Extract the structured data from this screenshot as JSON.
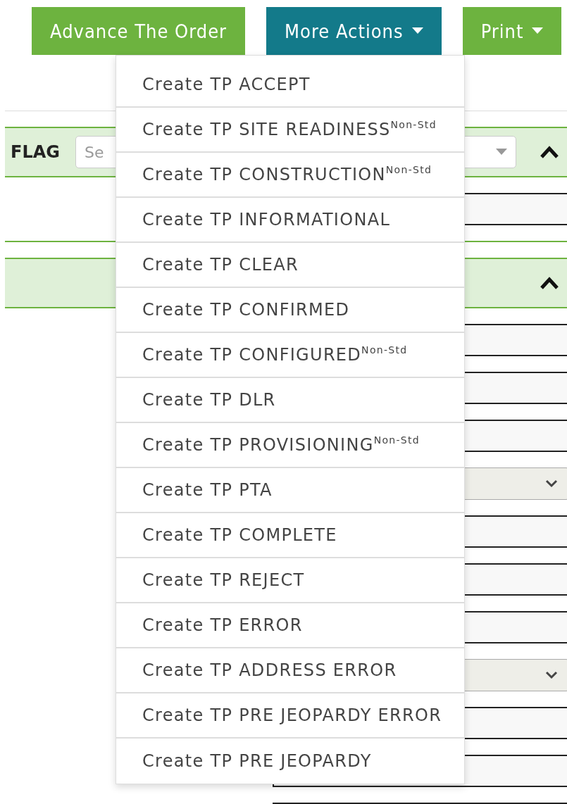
{
  "toolbar": {
    "buttons": [
      {
        "label": "Advance The Order",
        "kind": "primary",
        "caret": false
      },
      {
        "label": "More Actions",
        "kind": "menu",
        "caret": true,
        "expanded": true
      },
      {
        "label": "Print",
        "kind": "primary",
        "caret": true
      }
    ]
  },
  "sections": [
    {
      "label": "FLAG",
      "select": {
        "placeholder": "Se"
      },
      "expanded": true,
      "fields": [
        {
          "kind": "input"
        }
      ]
    },
    {
      "expanded": true,
      "fields": [
        {
          "kind": "input"
        },
        {
          "kind": "input"
        },
        {
          "kind": "input"
        },
        {
          "kind": "select"
        },
        {
          "kind": "input"
        },
        {
          "kind": "input"
        },
        {
          "kind": "input"
        },
        {
          "kind": "select"
        },
        {
          "kind": "input"
        },
        {
          "kind": "input"
        },
        {
          "kind": "input"
        }
      ]
    }
  ],
  "menu": {
    "items": [
      {
        "label": "Create TP ACCEPT"
      },
      {
        "label": "Create TP SITE READINESS$^{Non-Std}$"
      },
      {
        "label": "Create TP CONSTRUCTION$^{Non-Std}$"
      },
      {
        "label": "Create TP INFORMATIONAL"
      },
      {
        "label": "Create TP CLEAR"
      },
      {
        "label": "Create TP CONFIRMED"
      },
      {
        "label": "Create TP CONFIGURED$^{Non-Std}$"
      },
      {
        "label": "Create TP DLR"
      },
      {
        "label": "Create TP PROVISIONING$^{Non-Std}$"
      },
      {
        "label": "Create TP PTA"
      },
      {
        "label": "Create TP COMPLETE"
      },
      {
        "label": "Create TP REJECT"
      },
      {
        "label": "Create TP ERROR"
      },
      {
        "label": "Create TP ADDRESS ERROR"
      },
      {
        "label": "Create TP PRE JEOPARDY ERROR"
      },
      {
        "label": "Create TP PRE JEOPARDY"
      }
    ]
  }
}
